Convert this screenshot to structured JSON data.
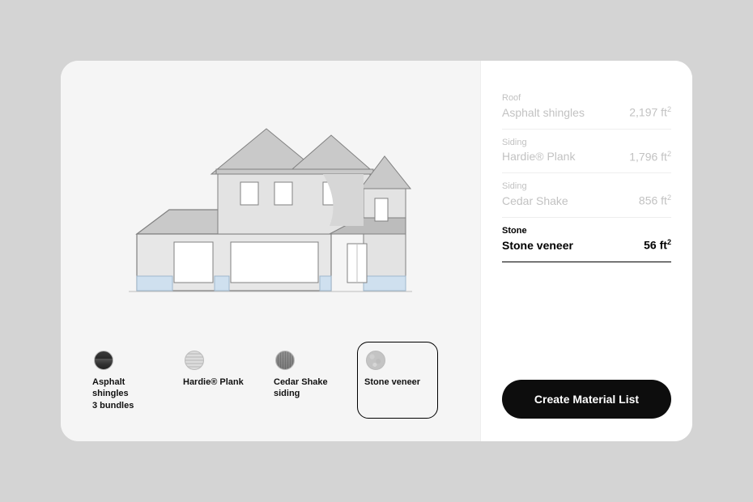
{
  "materials": [
    {
      "category": "Roof",
      "name": "Asphalt shingles",
      "area": "2,197 ft²",
      "active": false
    },
    {
      "category": "Siding",
      "name": "Hardie® Plank",
      "area": "1,796 ft²",
      "active": false
    },
    {
      "category": "Siding",
      "name": "Cedar Shake",
      "area": "856 ft²",
      "active": false
    },
    {
      "category": "Stone",
      "name": "Stone veneer",
      "area": "56 ft²",
      "active": true
    }
  ],
  "swatches": [
    {
      "label": "Asphalt shingles",
      "sub": "3 bundles",
      "chip": "asphalt",
      "selected": false
    },
    {
      "label": "Hardie® Plank",
      "sub": "",
      "chip": "hardie",
      "selected": false
    },
    {
      "label": "Cedar Shake",
      "sub": "siding",
      "chip": "cedar",
      "selected": false
    },
    {
      "label": "Stone veneer",
      "sub": "",
      "chip": "stone",
      "selected": true
    }
  ],
  "cta": {
    "label": "Create Material List"
  }
}
